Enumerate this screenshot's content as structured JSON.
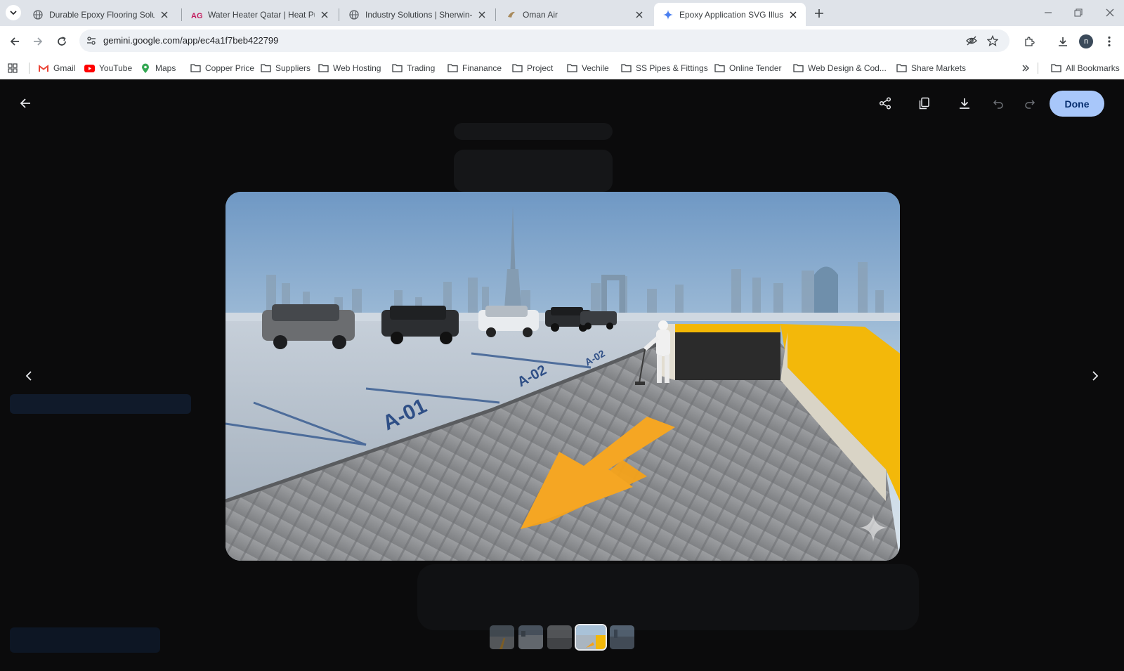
{
  "browser": {
    "tabs": [
      {
        "title": "Durable Epoxy Flooring Solutio",
        "icon": "globe-icon"
      },
      {
        "title": "Water Heater Qatar | Heat Pum",
        "icon": "ag-logo-icon"
      },
      {
        "title": "Industry Solutions | Sherwin-W",
        "icon": "globe-icon"
      },
      {
        "title": "Oman Air",
        "icon": "oman-air-icon"
      },
      {
        "title": "Epoxy Application SVG Illustrat",
        "icon": "gemini-sparkle-icon",
        "active": true
      }
    ],
    "url": "gemini.google.com/app/ec4a1f7beb422799",
    "profile_initial": "n",
    "bookmarks": [
      {
        "label": "Gmail",
        "icon": "gmail-icon"
      },
      {
        "label": "YouTube",
        "icon": "youtube-icon"
      },
      {
        "label": "Maps",
        "icon": "maps-icon"
      },
      {
        "label": "Copper Price",
        "icon": "folder-icon"
      },
      {
        "label": "Suppliers",
        "icon": "folder-icon"
      },
      {
        "label": "Web Hosting",
        "icon": "folder-icon"
      },
      {
        "label": "Trading",
        "icon": "folder-icon"
      },
      {
        "label": "Finanance",
        "icon": "folder-icon"
      },
      {
        "label": "Project",
        "icon": "folder-icon"
      },
      {
        "label": "Vechile",
        "icon": "folder-icon"
      },
      {
        "label": "SS Pipes & Fittings",
        "icon": "folder-icon"
      },
      {
        "label": "Online Tender",
        "icon": "folder-icon"
      },
      {
        "label": "Web Design & Cod...",
        "icon": "folder-icon"
      },
      {
        "label": "Share Markets",
        "icon": "folder-icon"
      }
    ],
    "all_bookmarks_label": "All Bookmarks"
  },
  "viewer": {
    "done_label": "Done",
    "accent_color": "#a8c7fa",
    "photo_description_icons": [
      "share-icon",
      "copy-icon",
      "download-icon",
      "undo-icon",
      "redo-icon"
    ],
    "parking_labels": [
      "A-01",
      "A-02",
      "A-02"
    ],
    "thumbnail_count": 5,
    "selected_thumbnail": 4
  }
}
